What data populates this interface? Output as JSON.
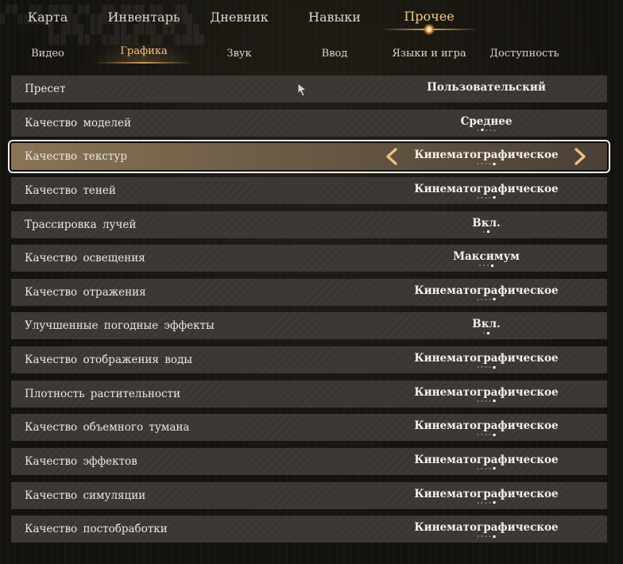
{
  "top_nav": {
    "tabs": [
      {
        "label": "Карта"
      },
      {
        "label": "Инвентарь"
      },
      {
        "label": "Дневник"
      },
      {
        "label": "Навыки"
      },
      {
        "label": "Прочее",
        "active": true
      }
    ]
  },
  "sub_nav": {
    "tabs": [
      {
        "label": "Видео"
      },
      {
        "label": "Графика",
        "active": true
      },
      {
        "label": "Звук"
      },
      {
        "label": "Ввод"
      },
      {
        "label": "Языки и игра"
      },
      {
        "label": "Доступность"
      }
    ]
  },
  "settings": [
    {
      "label": "Пресет",
      "value": "Пользовательский",
      "options_count": 0,
      "selected_index": -1
    },
    {
      "label": "Качество моделей",
      "value": "Среднее",
      "options_count": 5,
      "selected_index": 1
    },
    {
      "label": "Качество текстур",
      "value": "Кинематографическое",
      "options_count": 5,
      "selected_index": 4,
      "focused": true
    },
    {
      "label": "Качество теней",
      "value": "Кинематографическое",
      "options_count": 5,
      "selected_index": 4
    },
    {
      "label": "Трассировка лучей",
      "value": "Вкл.",
      "options_count": 2,
      "selected_index": 1
    },
    {
      "label": "Качество освещения",
      "value": "Максимум",
      "options_count": 4,
      "selected_index": 3
    },
    {
      "label": "Качество отражения",
      "value": "Кинематографическое",
      "options_count": 5,
      "selected_index": 4
    },
    {
      "label": "Улучшенные погодные эффекты",
      "value": "Вкл.",
      "options_count": 2,
      "selected_index": 1
    },
    {
      "label": "Качество отображения воды",
      "value": "Кинематографическое",
      "options_count": 5,
      "selected_index": 4
    },
    {
      "label": "Плотность растительности",
      "value": "Кинематографическое",
      "options_count": 5,
      "selected_index": 4
    },
    {
      "label": "Качество объемного тумана",
      "value": "Кинематографическое",
      "options_count": 5,
      "selected_index": 4
    },
    {
      "label": "Качество эффектов",
      "value": "Кинематографическое",
      "options_count": 5,
      "selected_index": 4
    },
    {
      "label": "Качество симуляции",
      "value": "Кинематографическое",
      "options_count": 5,
      "selected_index": 4
    },
    {
      "label": "Качество постобработки",
      "value": "Кинематографическое",
      "options_count": 5,
      "selected_index": 4
    }
  ],
  "colors": {
    "accent": "#f2c98a",
    "row_bg": "#3a3732",
    "selected_row_bg": "#8a7556",
    "arrow": "#f0c27e"
  },
  "icons": {
    "prev": "chevron-left-icon",
    "next": "chevron-right-icon",
    "cursor": "mouse-cursor-icon"
  }
}
